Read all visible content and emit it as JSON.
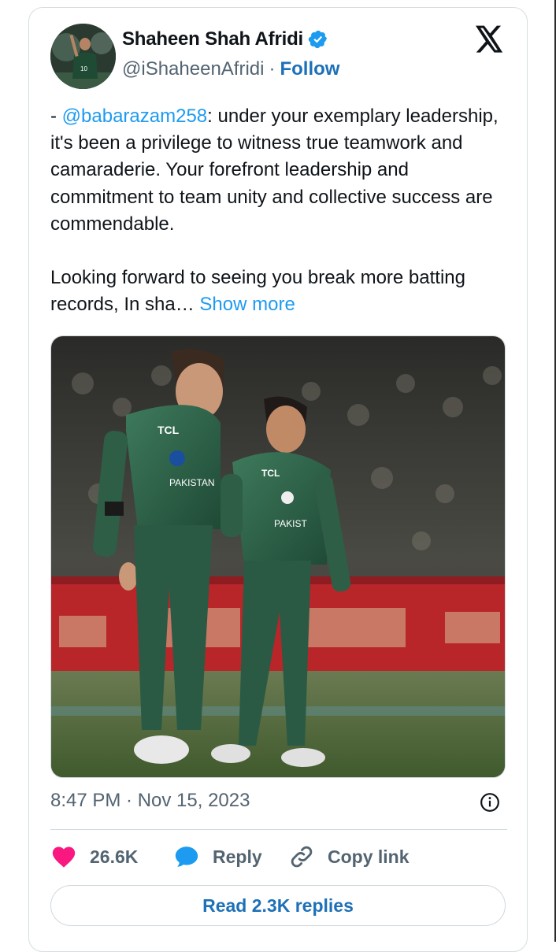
{
  "author": {
    "name": "Shaheen Shah Afridi",
    "handle": "@iShaheenAfridi",
    "separator": "·",
    "follow_label": "Follow"
  },
  "tweet": {
    "prefix": "- ",
    "mention": "@babarazam258",
    "para1_rest": ": under your exemplary leadership, it's been a privilege to witness true teamwork and camaraderie. Your forefront leadership and commitment to team unity and collective success are commendable.",
    "para2": "Looking forward to seeing you break more batting records, In sha… ",
    "show_more": "Show more"
  },
  "photo": {
    "jersey_text_1": "TCL",
    "jersey_text_2": "PAKISTAN",
    "jersey_text_3": "TCL",
    "jersey_text_4": "PAKIST"
  },
  "meta": {
    "timestamp": "8:47 PM · Nov 15, 2023"
  },
  "actions": {
    "likes": "26.6K",
    "reply_label": "Reply",
    "copy_label": "Copy link",
    "read_replies": "Read 2.3K replies"
  },
  "colors": {
    "link": "#1d9bf0",
    "follow": "#1d70b8",
    "like": "#f91880",
    "reply_icon": "#1d9bf0",
    "muted": "#536471"
  },
  "icons": [
    "verified-badge-icon",
    "x-logo-icon",
    "info-icon",
    "heart-icon",
    "reply-bubble-icon",
    "link-icon"
  ]
}
